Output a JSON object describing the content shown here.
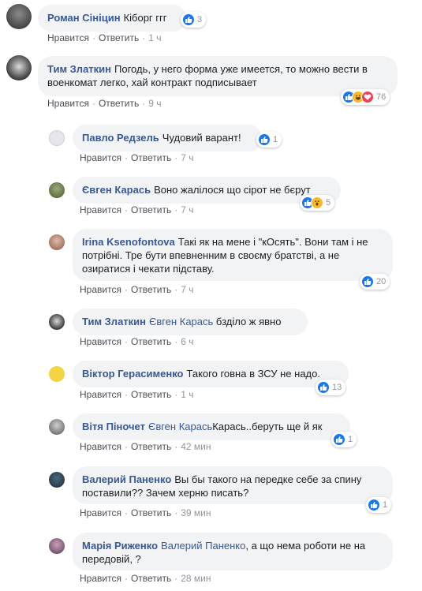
{
  "comments": [
    {
      "author": "Роман Сініцин",
      "mention": "",
      "text": "Кіборг ггг",
      "like": "Нравится",
      "reply": "Ответить",
      "time": "1 ч",
      "reactions": "3",
      "icons": [
        "like"
      ]
    },
    {
      "author": "Тим Златкин",
      "mention": "",
      "text": "Погодь, у него форма уже имеется, то можно вести в военкомат легко, хай контракт подписывает",
      "like": "Нравится",
      "reply": "Ответить",
      "time": "9 ч",
      "reactions": "76",
      "icons": [
        "like",
        "haha",
        "love"
      ]
    },
    {
      "author": "Павло Редзель",
      "mention": "",
      "text": "Чудовий варант!",
      "like": "Нравится",
      "reply": "Ответить",
      "time": "7 ч",
      "reactions": "1",
      "icons": [
        "like"
      ]
    },
    {
      "author": "Євген Карась",
      "mention": "",
      "text": "Воно жалілося що сірот не бєрут",
      "like": "Нравится",
      "reply": "Ответить",
      "time": "7 ч",
      "reactions": "5",
      "icons": [
        "like",
        "wow"
      ]
    },
    {
      "author": "Irina Ksenofontova",
      "mention": "",
      "text": "Такі як на мене і \"кОсять\". Вони там і не потрібні. Тре бути впевненним в своєму братстві, а не озиратися і чекати підставу.",
      "like": "Нравится",
      "reply": "Ответить",
      "time": "7 ч",
      "reactions": "20",
      "icons": [
        "like"
      ]
    },
    {
      "author": "Тим Златкин",
      "mention": "Євген Карась",
      "text": "бзділо ж явно",
      "like": "Нравится",
      "reply": "Ответить",
      "time": "6 ч",
      "reactions": "",
      "icons": []
    },
    {
      "author": "Віктор Герасименко",
      "mention": "",
      "text": "Такого говна в ЗСУ не надо.",
      "like": "Нравится",
      "reply": "Ответить",
      "time": "1 ч",
      "reactions": "13",
      "icons": [
        "like"
      ]
    },
    {
      "author": "Вітя Піночет",
      "mention": "Євген Карась",
      "text": "Карась..беруть ще й як",
      "like": "Нравится",
      "reply": "Ответить",
      "time": "42 мин",
      "reactions": "1",
      "icons": [
        "like"
      ]
    },
    {
      "author": "Валерий Паненко",
      "mention": "",
      "text": "Вы бы такого на передке себе за спину поставили?? Зачем херню писать?",
      "like": "Нравится",
      "reply": "Ответить",
      "time": "39 мин",
      "reactions": "1",
      "icons": [
        "like"
      ]
    },
    {
      "author": "Марія Риженко",
      "mention": "Валерий Паненко",
      "text": ", а що нема роботи не на передовій, ?",
      "like": "Нравится",
      "reply": "Ответить",
      "time": "28 мин",
      "reactions": "",
      "icons": []
    }
  ],
  "colors": {
    "link": "#385898",
    "bubble": "#f2f3f5",
    "meta": "#90949c",
    "like": "#1877f2"
  }
}
